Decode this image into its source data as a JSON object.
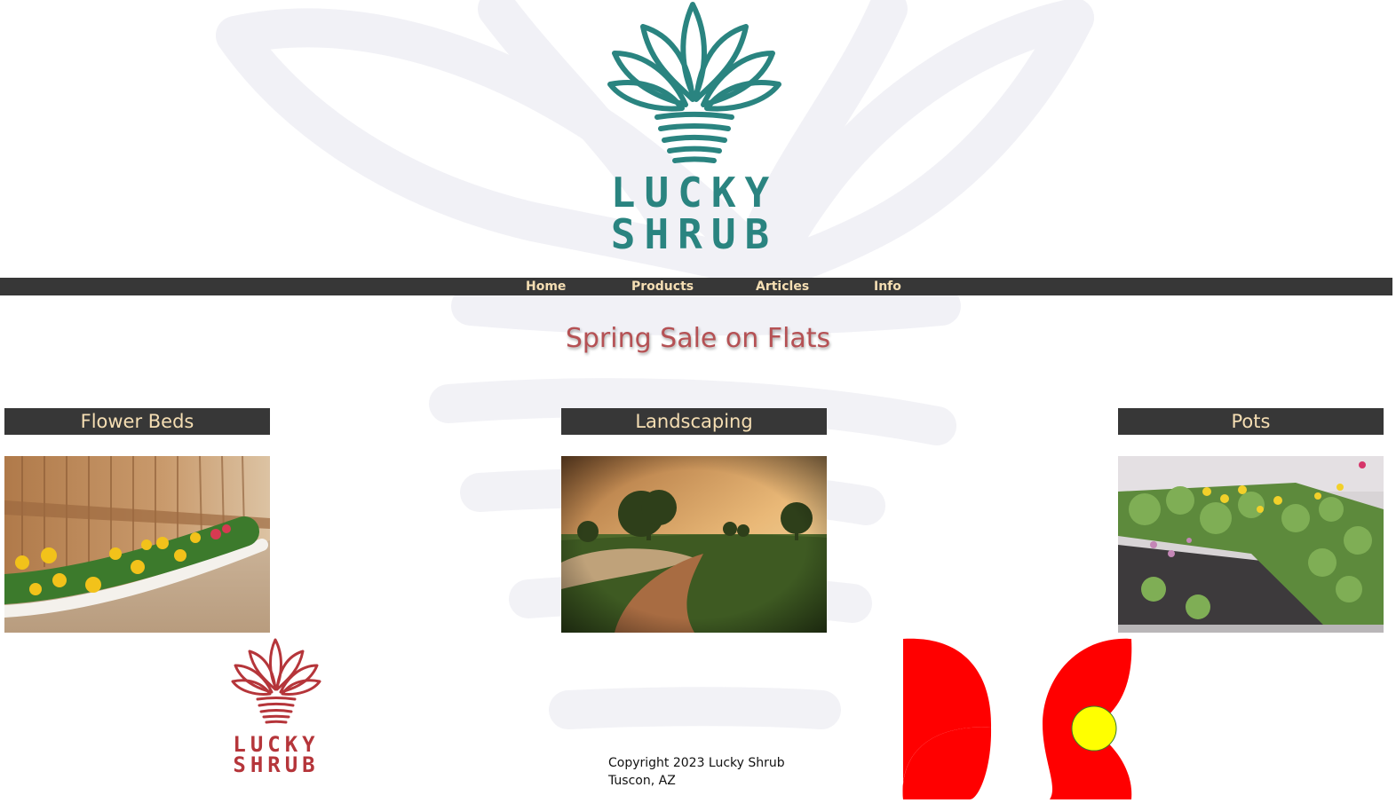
{
  "brand": {
    "logo_line1": "LUCKY",
    "logo_line2": "SHRUB",
    "logo_color": "#2a8480",
    "footer_logo_color": "#b5353a"
  },
  "nav": {
    "items": [
      {
        "label": "Home"
      },
      {
        "label": "Products"
      },
      {
        "label": "Articles"
      },
      {
        "label": "Info"
      }
    ]
  },
  "main": {
    "title": "Spring Sale on Flats",
    "cards": [
      {
        "heading": "Flower Beds"
      },
      {
        "heading": "Landscaping"
      },
      {
        "heading": "Pots"
      }
    ]
  },
  "footer": {
    "copyright_line1": "Copyright 2023 Lucky Shrub",
    "copyright_line2": "Tuscon, AZ"
  },
  "colors": {
    "nav_bg": "#373737",
    "nav_text": "#f5deb3",
    "title": "#b55154",
    "flower_petal": "#ff0000",
    "flower_center": "#ffff00"
  }
}
